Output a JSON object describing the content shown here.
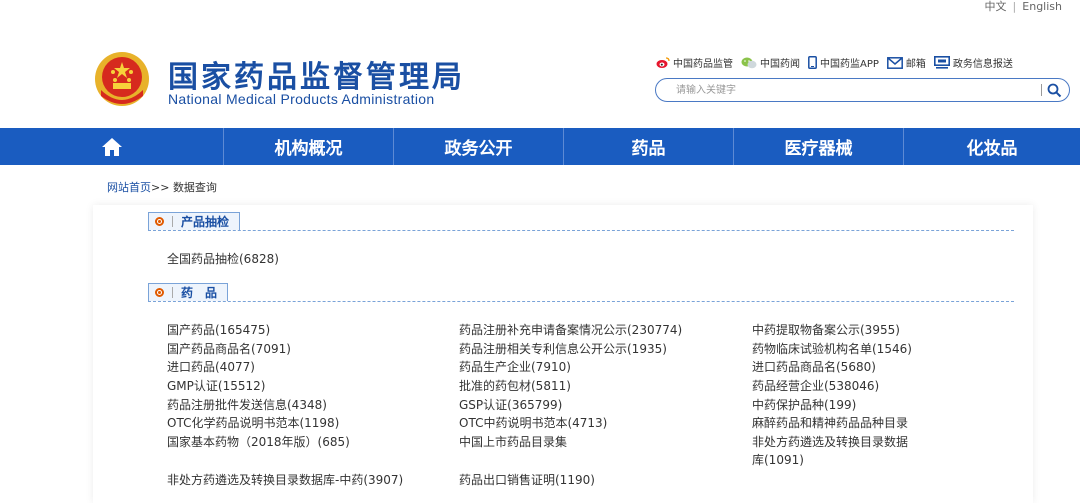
{
  "lang": {
    "cn": "中文",
    "en": "English",
    "sep": "|"
  },
  "header": {
    "title_cn": "国家药品监督管理局",
    "title_en": "National Medical Products Administration"
  },
  "quick_links": [
    {
      "label": "中国药品监管",
      "icon": "weibo-icon"
    },
    {
      "label": "中国药闻",
      "icon": "wechat-icon"
    },
    {
      "label": "中国药监APP",
      "icon": "phone-icon"
    },
    {
      "label": "邮箱",
      "icon": "mail-icon"
    },
    {
      "label": "政务信息报送",
      "icon": "monitor-icon"
    }
  ],
  "search": {
    "placeholder": "请输入关键字"
  },
  "nav": {
    "items": [
      "机构概况",
      "政务公开",
      "药品",
      "医疗器械",
      "化妆品"
    ]
  },
  "breadcrumb": {
    "home": "网站首页",
    "sep": ">>",
    "current": "数据查询"
  },
  "sections": [
    {
      "title": "产品抽检",
      "items": [
        "全国药品抽检(6828)"
      ]
    },
    {
      "title": "药　品",
      "col1": [
        "国产药品(165475)",
        "国产药品商品名(7091)",
        "进口药品(4077)",
        "GMP认证(15512)",
        "药品注册批件发送信息(4348)",
        "OTC化学药品说明书范本(1198)",
        "国家基本药物（2018年版）(685)",
        "非处方药遴选及转换目录数据库-中药(3907)"
      ],
      "col2": [
        "药品注册补充申请备案情况公示(230774)",
        "药品注册相关专利信息公开公示(1935)",
        "药品生产企业(7910)",
        "批准的药包材(5811)",
        "GSP认证(365799)",
        "OTC中药说明书范本(4713)",
        "中国上市药品目录集",
        "药品出口销售证明(1190)"
      ],
      "col3": [
        "中药提取物备案公示(3955)",
        "药物临床试验机构名单(1546)",
        "进口药品商品名(5680)",
        "药品经营企业(538046)",
        "中药保护品种(199)",
        "麻醉药品和精神药品品种目录",
        "非处方药遴选及转换目录数据库(1091)"
      ]
    }
  ],
  "colors": {
    "brand": "#1a4fa3",
    "nav_bg": "#1a5cc0",
    "accent": "#e05a00"
  }
}
